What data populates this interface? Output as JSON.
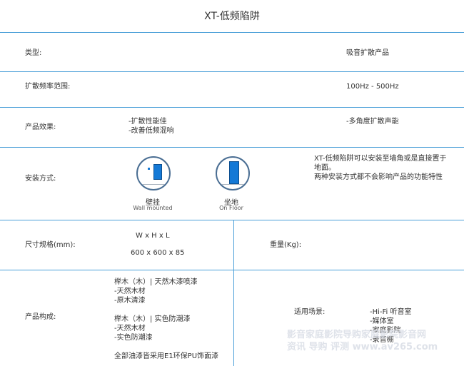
{
  "title": "XT-低频陷阱",
  "rows": {
    "type": {
      "label": "类型:",
      "value": "吸音扩散产品"
    },
    "range": {
      "label": "扩散频率范围:",
      "value": "100Hz - 500Hz"
    },
    "effect": {
      "label": "产品效果:",
      "left": [
        "-扩散性能佳",
        "-改善低频混响"
      ],
      "right": "-多角度扩散声能"
    },
    "install": {
      "label": "安装方式:",
      "wall_cn": "壁挂",
      "wall_en": "Wall mounted",
      "floor_cn": "坐地",
      "floor_en": "On Floor",
      "desc": [
        "XT-低频陷阱可以安装至墙角或是直接置于",
        "地面。",
        "两种安装方式都不会影响产品的功能特性"
      ]
    },
    "size": {
      "label": "尺寸规格(mm):",
      "dims_label": "W x H x L",
      "dims": "600 x 600 x 85",
      "weight_label": "重量(Kg):"
    },
    "build": {
      "label": "产品构成:",
      "lines": [
        "榉木（木）| 天然木漆喷漆",
        "-天然木材",
        "-原木清漆",
        "",
        "榉木（木）| 实色防潮漆",
        "-天然木材",
        "-实色防潮漆",
        "",
        "全部油漆皆采用E1环保PU饰面漆"
      ],
      "scene_label": "适用场景:",
      "scenes": [
        "-Hi-Fi 听音室",
        "-媒体室",
        "-家庭影院",
        "-录音棚"
      ]
    }
  },
  "watermark": {
    "line1": "影音家庭影院导购家庭影院影音网",
    "line2": "资讯 导购 评测 www.av265.com"
  },
  "colors": {
    "divider": "#4a9fd8",
    "icon_fill": "#1479d6",
    "icon_ring": "#4a6e93"
  }
}
